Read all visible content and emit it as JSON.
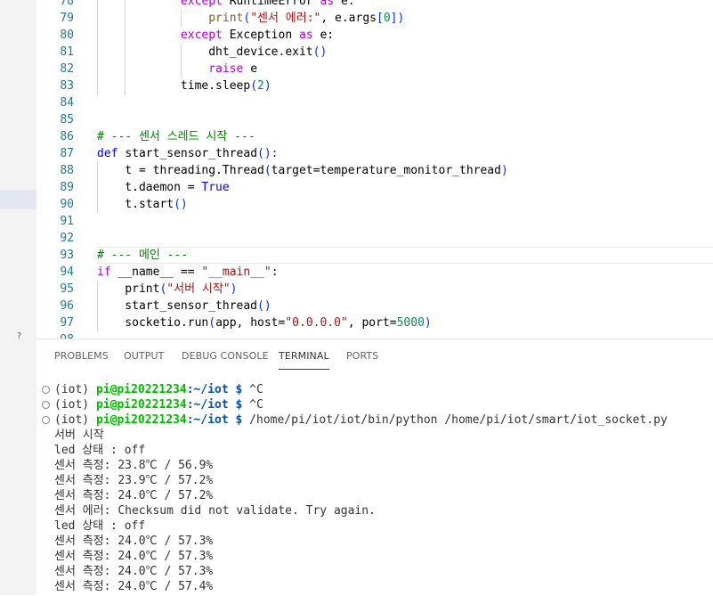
{
  "editor": {
    "lines": [
      {
        "n": "78",
        "tokens": [
          [
            "            ",
            ""
          ],
          [
            "except ",
            "kw2"
          ],
          [
            "RuntimeError ",
            ""
          ],
          [
            "as ",
            "kw2"
          ],
          [
            "e:",
            ""
          ]
        ]
      },
      {
        "n": "79",
        "tokens": [
          [
            "                ",
            ""
          ],
          [
            "print",
            "bi"
          ],
          [
            "(",
            "br"
          ],
          [
            "\"센서 에러:\"",
            "str"
          ],
          [
            ", e.args",
            ""
          ],
          [
            "[",
            "br"
          ],
          [
            "0",
            "num"
          ],
          [
            "]",
            "br"
          ],
          [
            ")",
            "br"
          ]
        ]
      },
      {
        "n": "80",
        "tokens": [
          [
            "            ",
            ""
          ],
          [
            "except ",
            "kw2"
          ],
          [
            "Exception ",
            ""
          ],
          [
            "as ",
            "kw2"
          ],
          [
            "e:",
            ""
          ]
        ]
      },
      {
        "n": "81",
        "tokens": [
          [
            "                ",
            ""
          ],
          [
            "dht_device.exit",
            ""
          ],
          [
            "()",
            "br"
          ]
        ]
      },
      {
        "n": "82",
        "tokens": [
          [
            "                ",
            ""
          ],
          [
            "raise ",
            "kw2"
          ],
          [
            "e",
            ""
          ]
        ]
      },
      {
        "n": "83",
        "tokens": [
          [
            "            ",
            ""
          ],
          [
            "time.sleep",
            ""
          ],
          [
            "(",
            "br"
          ],
          [
            "2",
            "num"
          ],
          [
            ")",
            "br"
          ]
        ]
      },
      {
        "n": "84",
        "tokens": []
      },
      {
        "n": "85",
        "tokens": []
      },
      {
        "n": "86",
        "tokens": [
          [
            "# --- 센서 스레드 시작 ---",
            "cmt"
          ]
        ]
      },
      {
        "n": "87",
        "tokens": [
          [
            "def ",
            "kw"
          ],
          [
            "start_sensor_thread",
            ""
          ],
          [
            "():",
            "br"
          ]
        ]
      },
      {
        "n": "88",
        "tokens": [
          [
            "    t = threading.Thread",
            ""
          ],
          [
            "(",
            "br"
          ],
          [
            "target=temperature_monitor_thread",
            ""
          ],
          [
            ")",
            "br"
          ]
        ]
      },
      {
        "n": "89",
        "tokens": [
          [
            "    t.daemon = ",
            ""
          ],
          [
            "True",
            "kw"
          ]
        ]
      },
      {
        "n": "90",
        "tokens": [
          [
            "    t.start",
            ""
          ],
          [
            "()",
            "br"
          ]
        ]
      },
      {
        "n": "91",
        "tokens": []
      },
      {
        "n": "92",
        "tokens": []
      },
      {
        "n": "93",
        "tokens": [
          [
            "# --- 메인 ---",
            "cmt"
          ]
        ]
      },
      {
        "n": "94",
        "tokens": [
          [
            "if ",
            "kw2"
          ],
          [
            "__name__ == ",
            ""
          ],
          [
            "\"__main__\"",
            "str"
          ],
          [
            ":",
            ""
          ]
        ]
      },
      {
        "n": "95",
        "tokens": [
          [
            "    print",
            ""
          ],
          [
            "(",
            "br"
          ],
          [
            "\"서버 시작\"",
            "str"
          ],
          [
            ")",
            "br"
          ]
        ]
      },
      {
        "n": "96",
        "tokens": [
          [
            "    start_sensor_thread",
            ""
          ],
          [
            "()",
            "br"
          ]
        ]
      },
      {
        "n": "97",
        "tokens": [
          [
            "    socketio.run",
            ""
          ],
          [
            "(",
            "br"
          ],
          [
            "app, host=",
            ""
          ],
          [
            "\"0.0.0.0\"",
            "str"
          ],
          [
            ", port=",
            ""
          ],
          [
            "5000",
            "num"
          ],
          [
            ")",
            "br"
          ]
        ]
      },
      {
        "n": "98",
        "tokens": []
      }
    ]
  },
  "panel": {
    "tabs": [
      "PROBLEMS",
      "OUTPUT",
      "DEBUG CONSOLE",
      "TERMINAL",
      "PORTS"
    ],
    "active_tab": "TERMINAL"
  },
  "terminal": {
    "prompt_prefix": "(iot) ",
    "user_host": "pi@pi20221234",
    "cwd": ":~/iot $",
    "commands": [
      " ^C",
      " ^C",
      " /home/pi/iot/iot/bin/python /home/pi/iot/smart/iot_socket.py"
    ],
    "output": [
      "서버 시작",
      "led 상태 : off",
      "센서 측정: 23.8℃ / 56.9%",
      "센서 측정: 23.9℃ / 57.2%",
      "센서 측정: 24.0℃ / 57.2%",
      "센서 에러: Checksum did not validate. Try again.",
      "led 상태 : off",
      "센서 측정: 24.0℃ / 57.3%",
      "센서 측정: 24.0℃ / 57.3%",
      "센서 측정: 24.0℃ / 57.3%",
      "센서 측정: 24.0℃ / 57.4%"
    ]
  },
  "misc": {
    "left_strip_glyph": "?"
  }
}
